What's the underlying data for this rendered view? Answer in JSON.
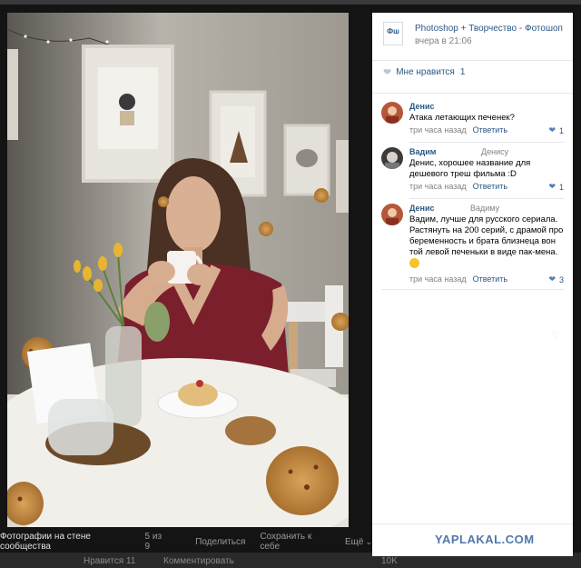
{
  "post": {
    "group_name": "Photoshop + Творчество - Фотошоп",
    "date": "вчера в 21:06",
    "group_avatar_text": "Фш",
    "likes_label": "Мне нравится",
    "likes_count": "1"
  },
  "comments": [
    {
      "author": "Денис",
      "reply_to": "",
      "text": "Атака летающих печенек?",
      "time": "три часа назад",
      "reply_label": "Ответить",
      "likes": "1"
    },
    {
      "author": "Вадим",
      "reply_to": "Денису",
      "text": "Денис, хорошее название для дешевого треш фильма :D",
      "time": "три часа назад",
      "reply_label": "Ответить",
      "likes": "1"
    },
    {
      "author": "Денис",
      "reply_to": "Вадиму",
      "text": "Вадим, лучше для русского сериала. Растянуть на 200 серий, с драмой про беременность и брата близнеца вон той левой печеньки в виде пак-мена.",
      "time": "три часа назад",
      "reply_label": "Ответить",
      "likes": "3"
    }
  ],
  "photo_bar": {
    "title": "Фотографии на стене сообщества",
    "counter": "5 из 9",
    "share": "Поделиться",
    "save": "Сохранить к себе",
    "more": "Ещё"
  },
  "under_bar": {
    "likes": "Нравится 11",
    "comments": "Комментировать",
    "right": "10K"
  },
  "watermark": "YAPLAKAL.COM",
  "colors": {
    "link": "#2a5885",
    "meta": "#828282",
    "heart_active": "#5181b8"
  }
}
